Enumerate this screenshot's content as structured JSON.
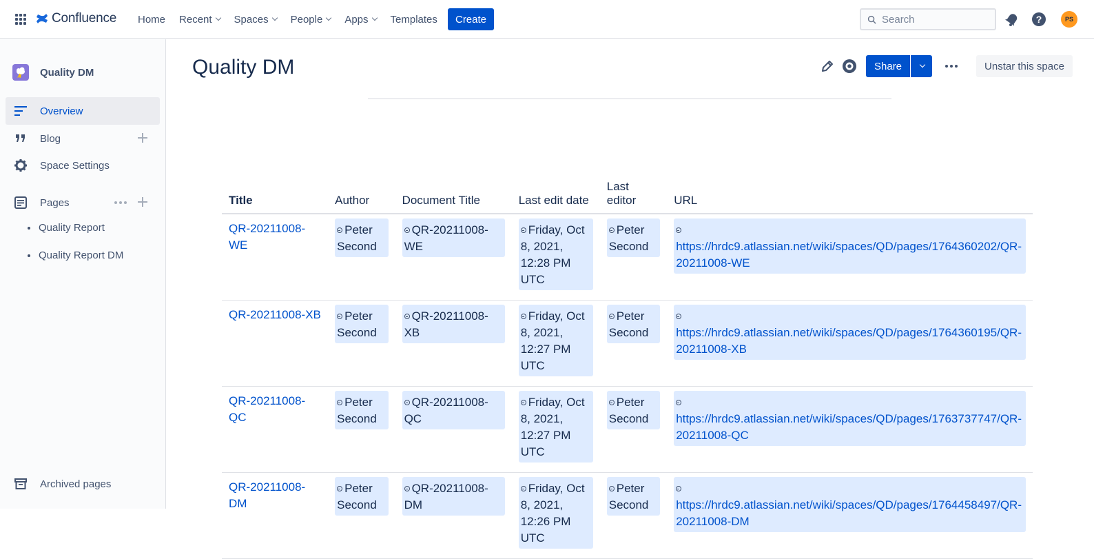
{
  "topbar": {
    "logo_text": "Confluence",
    "nav": [
      {
        "label": "Home",
        "dropdown": false
      },
      {
        "label": "Recent",
        "dropdown": true
      },
      {
        "label": "Spaces",
        "dropdown": true
      },
      {
        "label": "People",
        "dropdown": true
      },
      {
        "label": "Apps",
        "dropdown": true
      },
      {
        "label": "Templates",
        "dropdown": false
      }
    ],
    "create_label": "Create",
    "search_placeholder": "Search",
    "avatar_initials": "PS"
  },
  "sidebar": {
    "space_name": "Quality DM",
    "items": [
      {
        "label": "Overview",
        "icon": "overview-icon",
        "active": true
      },
      {
        "label": "Blog",
        "icon": "quote-icon"
      },
      {
        "label": "Space Settings",
        "icon": "gear-icon"
      }
    ],
    "pages_label": "Pages",
    "pages": [
      "Quality Report",
      "Quality Report DM"
    ],
    "archived_label": "Archived pages"
  },
  "main": {
    "title": "Quality DM",
    "share_label": "Share",
    "unstar_label": "Unstar this space",
    "table": {
      "headers": [
        "Title",
        "Author",
        "Document Title",
        "Last edit date",
        "Last editor",
        "URL"
      ],
      "rows": [
        {
          "title": "QR-20211008-WE",
          "author": "Peter Second",
          "doc_title": "QR-20211008-WE",
          "date": "Friday, Oct 8, 2021, 12:28 PM UTC",
          "editor": "Peter Second",
          "url": "https://hrdc9.atlassian.net/wiki/spaces/QD/pages/1764360202/QR-20211008-WE"
        },
        {
          "title": "QR-20211008-XB",
          "author": "Peter Second",
          "doc_title": "QR-20211008-XB",
          "date": "Friday, Oct 8, 2021, 12:27 PM UTC",
          "editor": "Peter Second",
          "url": "https://hrdc9.atlassian.net/wiki/spaces/QD/pages/1764360195/QR-20211008-XB"
        },
        {
          "title": "QR-20211008-QC",
          "author": "Peter Second",
          "doc_title": "QR-20211008-QC",
          "date": "Friday, Oct 8, 2021, 12:27 PM UTC",
          "editor": "Peter Second",
          "url": "https://hrdc9.atlassian.net/wiki/spaces/QD/pages/1763737747/QR-20211008-QC"
        },
        {
          "title": "QR-20211008-DM",
          "author": "Peter Second",
          "doc_title": "QR-20211008-DM",
          "date": "Friday, Oct 8, 2021, 12:26 PM UTC",
          "editor": "Peter Second",
          "url": "https://hrdc9.atlassian.net/wiki/spaces/QD/pages/1764458497/QR-20211008-DM"
        }
      ]
    }
  },
  "colors": {
    "brand": "#0052cc",
    "chip_bg": "#deebff",
    "avatar": "#ff991f",
    "space_avatar": "#8777d9"
  }
}
